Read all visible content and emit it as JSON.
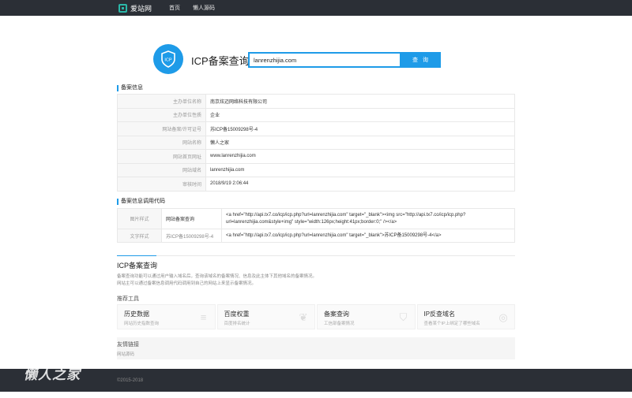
{
  "nav": {
    "logo": "爱站网",
    "items": [
      "首页",
      "懒人源码"
    ]
  },
  "search": {
    "title": "ICP备案查询",
    "value": "lanrenzhijia.com",
    "button": "查 询",
    "badge": "ICP"
  },
  "info": {
    "section_title": "备案信息",
    "rows": [
      {
        "label": "主办单位名称",
        "value": "南京炫迈网络科技有限公司"
      },
      {
        "label": "主办单位性质",
        "value": "企业"
      },
      {
        "label": "网站备案/许可证号",
        "value": "苏ICP备15009298号-4"
      },
      {
        "label": "网站名称",
        "value": "懒人之家"
      },
      {
        "label": "网站首页网址",
        "value": "www.lanrenzhijia.com"
      },
      {
        "label": "网站域名",
        "value": "lanrenzhijia.com"
      },
      {
        "label": "审核时间",
        "value": "2018/9/19 2:06:44"
      }
    ]
  },
  "code": {
    "section_title": "备案信息调用代码",
    "rows": [
      {
        "type": "图片样式",
        "name": "网站备案查询",
        "code": "<a href=\"http://api.tx7.co/icp/icp.php?url=lanrenzhijia.com\" target=\"_blank\"><img src=\"http://api.tx7.co/icp/icp.php?url=lanrenzhijia.com&style+img\" style=\"width:126px;height:41px;border:0;\" /></a>"
      },
      {
        "type": "文字样式",
        "name": "苏ICP备15009298号-4",
        "code": "<a href=\"http://api.tx7.co/icp/icp.php?url=lanrenzhijia.com\" target=\"_blank\">苏ICP备15009298号-4</a>"
      }
    ]
  },
  "about": {
    "title": "ICP备案查询",
    "lines": [
      "备案查询功能可以通过用户输入域名后，查询该域名的备案情况、信息及此主体下其他域名的备案情况。",
      "网站主可以通过备案信息调用代码调用到自己的网站上来显示备案情况。"
    ]
  },
  "tools": {
    "title": "推荐工具",
    "items": [
      {
        "name": "历史数据",
        "desc": "网站历史指数查询",
        "icon": "stack-icon"
      },
      {
        "name": "百度权重",
        "desc": "百度排名统计",
        "icon": "paw-icon"
      },
      {
        "name": "备案查询",
        "desc": "工信部备案情况",
        "icon": "icp-icon"
      },
      {
        "name": "IP反查域名",
        "desc": "查看某个IP上绑定了哪些域名",
        "icon": "ip-icon"
      }
    ]
  },
  "links": {
    "title": "友情链接",
    "item": "网站源码"
  },
  "footer": {
    "copyright": "©2015-2018",
    "watermark": "懒人之家"
  },
  "colors": {
    "accent": "#1e9be8",
    "nav_bg": "#2b2f36"
  }
}
